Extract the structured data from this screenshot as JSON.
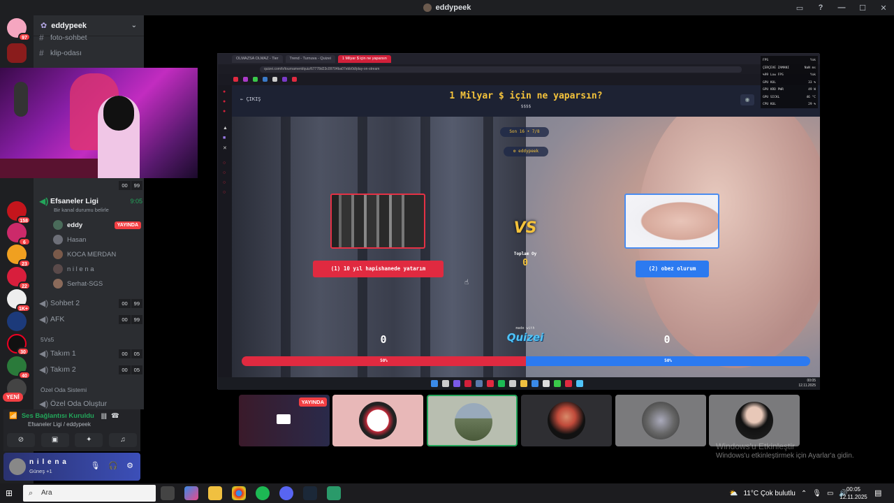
{
  "window": {
    "title": "eddypeek"
  },
  "server": {
    "name": "eddypeek"
  },
  "channels": [
    {
      "name": "foto-sohbet"
    },
    {
      "name": "klip-odası"
    }
  ],
  "voice_channel_main": {
    "name": "Efsaneler Ligi",
    "time": "9:05",
    "status": "Bir kanal durumu belirle",
    "members": [
      {
        "name": "eddy",
        "badge": "YAYINDA"
      },
      {
        "name": "Hasan"
      },
      {
        "name": "KOCA MERDAN"
      },
      {
        "name": "n i l e n a"
      },
      {
        "name": "Serhat-SGS"
      }
    ]
  },
  "voice_channels": [
    {
      "name": "Sohbet 2",
      "count_a": "00",
      "count_b": "99"
    },
    {
      "name": "AFK",
      "count_a": "00",
      "count_b": "99"
    }
  ],
  "section_5v5": "5Vs5",
  "team_channels": [
    {
      "name": "Takım 1",
      "count_a": "00",
      "count_b": "05"
    },
    {
      "name": "Takım 2",
      "count_a": "00",
      "count_b": "05"
    }
  ],
  "section_private": "Özel Oda Sistemi",
  "private_create": "Özel Oda Oluştur",
  "webcam_channel": {
    "count_a": "00",
    "count_b": "99"
  },
  "rail_badges": [
    "97",
    "158",
    "6",
    "23",
    "22",
    "1K+",
    "30",
    "40"
  ],
  "rail_new": "YENİ",
  "voice_panel": {
    "status": "Ses Bağlantısı Kuruldu",
    "sub": "Efsaneler Ligi / eddypeek"
  },
  "user_panel": {
    "name": "n i l e n a",
    "activity": "Güneş +1"
  },
  "browser": {
    "tabs": [
      "OLMAZSA OLMAZ - Tier",
      "Trend - Turnuva - Quizei",
      "1 Milyar $ için ne yaparsın"
    ],
    "url": "quizei.com/tr/tournament/quiz/67778d23c09704ba07ebb0d/play-on-stream"
  },
  "perf_overlay": [
    {
      "k": "FPS",
      "v": "Yok"
    },
    {
      "k": "ÇERÇEVE ZAMANI",
      "v": "NaN ms"
    },
    {
      "k": "%99 Low FPS",
      "v": "Yok"
    },
    {
      "k": "GPU KUL",
      "v": "33 %"
    },
    {
      "k": "GPU KRD PWR",
      "v": "49 W"
    },
    {
      "k": "GPU SICKL",
      "v": "46 °C"
    },
    {
      "k": "CPU KUL",
      "v": "29 %"
    }
  ],
  "quiz": {
    "back_label": "ÇIKIŞ",
    "title": "1 Milyar $ için ne yaparsın?",
    "subtitle": "$$$$",
    "round": "Son 16 • 7/8",
    "streamer": "eddypeek",
    "option_a": "(1) 10 yıl hapishanede yatarım",
    "option_b": "(2) obez olurum",
    "vs": "VS",
    "total_label": "Toplam Oy",
    "total_value": "0",
    "made_with": "made with",
    "brand": "Quizei",
    "score_a": "0",
    "score_b": "0",
    "percent_a": "50%",
    "percent_b": "50%",
    "share_a": 0.5
  },
  "stream_clock": {
    "time": "00:05",
    "date": "12.11.2025"
  },
  "tiles": [
    {
      "live": "YAYINDA"
    }
  ],
  "activation": {
    "title": "Windows'u Etkinleştir",
    "sub": "Windows'u etkinleştirmek için Ayarlar'a gidin."
  },
  "taskbar": {
    "search_placeholder": "Ara",
    "weather": "11°C  Çok bulutlu",
    "time": "00:05",
    "date": "12.11.2025"
  }
}
